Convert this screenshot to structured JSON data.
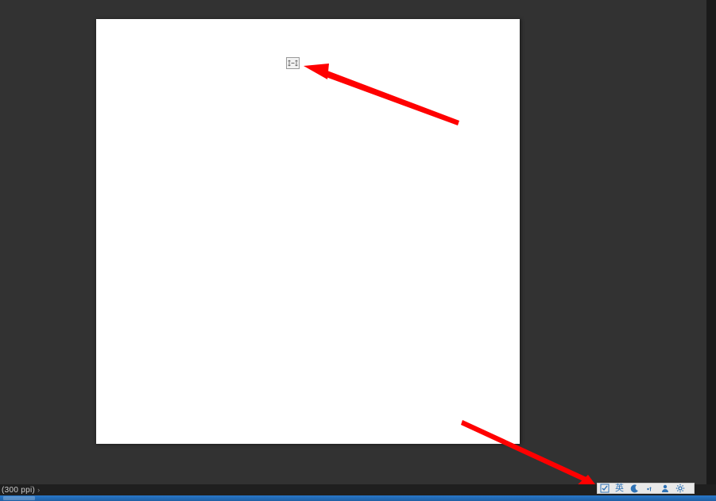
{
  "statusbar": {
    "resolution_label": "(300 ppi)",
    "chevron": "›"
  },
  "ime": {
    "language_label": "英"
  },
  "annotation": {
    "arrow_color": "#ff0000"
  }
}
